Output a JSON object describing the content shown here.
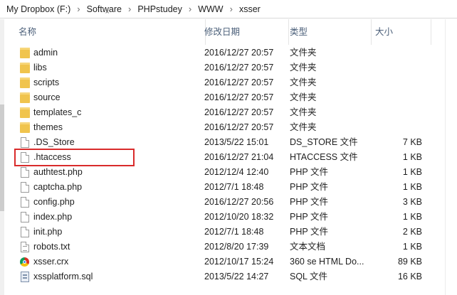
{
  "breadcrumb": [
    "My Dropbox (F:)",
    "Software",
    "PHPstudey",
    "WWW",
    "xsser"
  ],
  "columns": {
    "name": "名称",
    "date": "修改日期",
    "type": "类型",
    "size": "大小"
  },
  "files": [
    {
      "name": "admin",
      "date": "2016/12/27 20:57",
      "type": "文件夹",
      "size": "",
      "icon": "folder-icon"
    },
    {
      "name": "libs",
      "date": "2016/12/27 20:57",
      "type": "文件夹",
      "size": "",
      "icon": "folder-icon"
    },
    {
      "name": "scripts",
      "date": "2016/12/27 20:57",
      "type": "文件夹",
      "size": "",
      "icon": "folder-icon"
    },
    {
      "name": "source",
      "date": "2016/12/27 20:57",
      "type": "文件夹",
      "size": "",
      "icon": "folder-icon"
    },
    {
      "name": "templates_c",
      "date": "2016/12/27 20:57",
      "type": "文件夹",
      "size": "",
      "icon": "folder-icon"
    },
    {
      "name": "themes",
      "date": "2016/12/27 20:57",
      "type": "文件夹",
      "size": "",
      "icon": "folder-icon"
    },
    {
      "name": ".DS_Store",
      "date": "2013/5/22 15:01",
      "type": "DS_STORE 文件",
      "size": "7 KB",
      "icon": "file-icon"
    },
    {
      "name": ".htaccess",
      "date": "2016/12/27 21:04",
      "type": "HTACCESS 文件",
      "size": "1 KB",
      "icon": "file-icon"
    },
    {
      "name": "authtest.php",
      "date": "2012/12/4 12:40",
      "type": "PHP 文件",
      "size": "1 KB",
      "icon": "file-icon"
    },
    {
      "name": "captcha.php",
      "date": "2012/7/1 18:48",
      "type": "PHP 文件",
      "size": "1 KB",
      "icon": "file-icon"
    },
    {
      "name": "config.php",
      "date": "2016/12/27 20:56",
      "type": "PHP 文件",
      "size": "3 KB",
      "icon": "file-icon"
    },
    {
      "name": "index.php",
      "date": "2012/10/20 18:32",
      "type": "PHP 文件",
      "size": "1 KB",
      "icon": "file-icon"
    },
    {
      "name": "init.php",
      "date": "2012/7/1 18:48",
      "type": "PHP 文件",
      "size": "2 KB",
      "icon": "file-icon"
    },
    {
      "name": "robots.txt",
      "date": "2012/8/20 17:39",
      "type": "文本文档",
      "size": "1 KB",
      "icon": "text-file-icon"
    },
    {
      "name": "xsser.crx",
      "date": "2012/10/17 15:24",
      "type": "360 se HTML Do...",
      "size": "89 KB",
      "icon": "crx-file-icon"
    },
    {
      "name": "xssplatform.sql",
      "date": "2013/5/22 14:27",
      "type": "SQL 文件",
      "size": "16 KB",
      "icon": "sql-file-icon"
    }
  ],
  "highlight_color": "#d92b2b",
  "folder_color": "#f0c44d"
}
